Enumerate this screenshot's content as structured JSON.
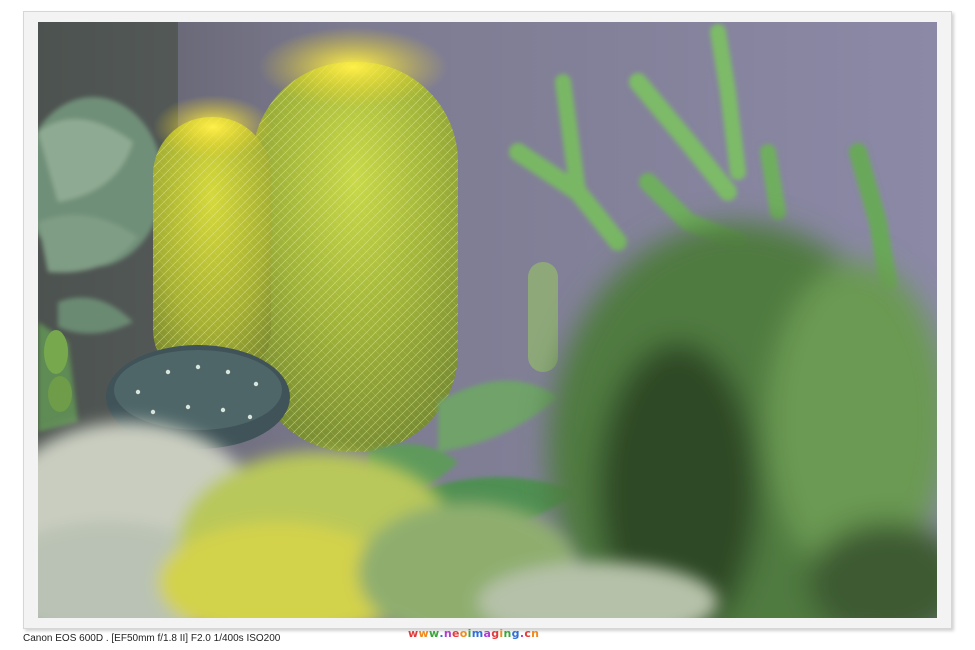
{
  "photo": {
    "subject": "cactus-and-succulents"
  },
  "caption": {
    "exif": "Canon EOS 600D . [EF50mm f/1.8 II] F2.0 1/400s ISO200"
  },
  "watermark": {
    "text": "www.neoimaging.cn",
    "colors": [
      "#e23b3b",
      "#f08a1c",
      "#3aa63a",
      "#2f6fd6",
      "#b23bd0",
      "#e23b3b",
      "#f08a1c",
      "#3aa63a",
      "#2f6fd6",
      "#b23bd0",
      "#e23b3b",
      "#f08a1c",
      "#3aa63a",
      "#2f6fd6",
      "#b23bd0",
      "#e23b3b",
      "#f08a1c"
    ]
  }
}
